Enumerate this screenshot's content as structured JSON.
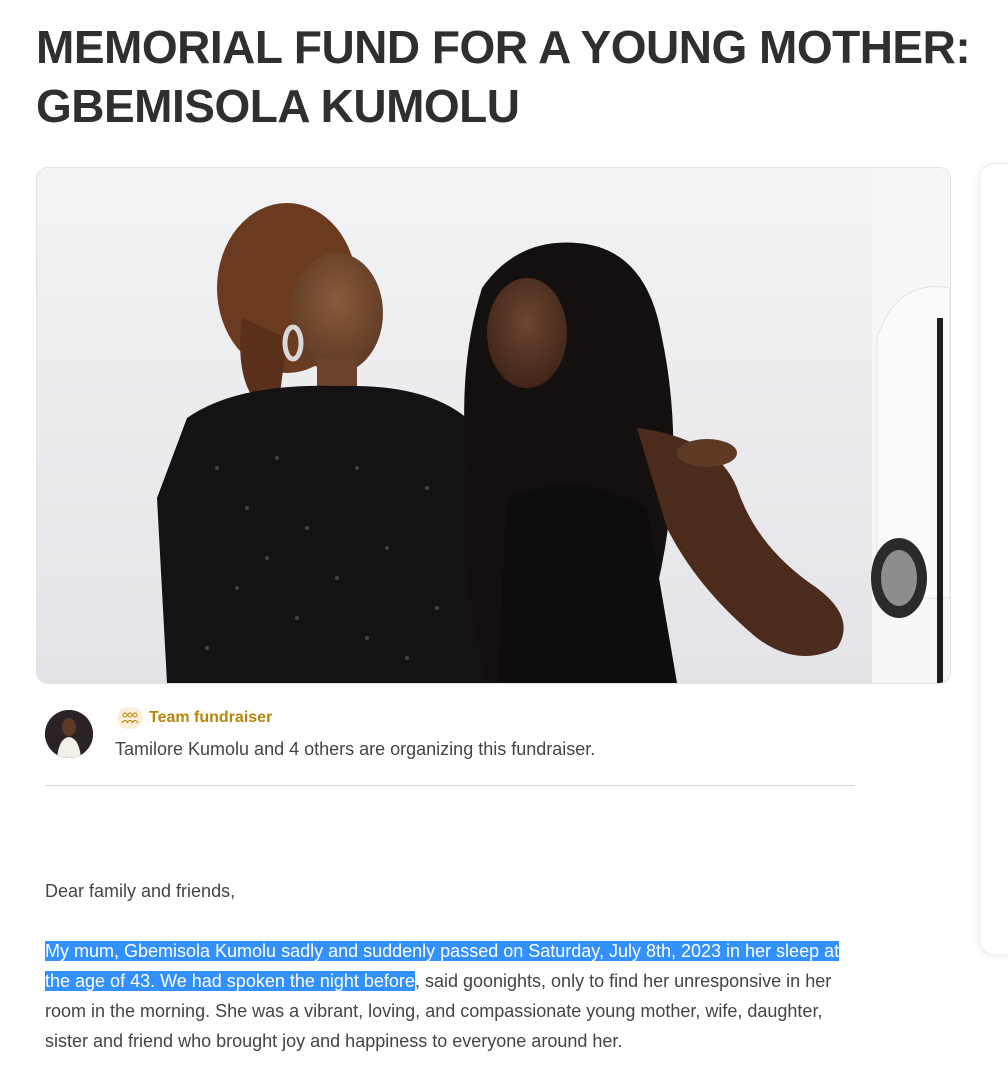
{
  "page": {
    "title_line1": "MEMORIAL FUND FOR A YOUNG MOTHER:",
    "title_line2": "GBEMISOLA  KUMOLU"
  },
  "organizer": {
    "team_label": "Team fundraiser",
    "text": "Tamilore Kumolu and 4 others are organizing this fundraiser.",
    "team_icon": "people-group-icon"
  },
  "story": {
    "greeting": "Dear family and friends,",
    "highlighted": "My mum, Gbemisola Kumolu sadly and suddenly passed on Saturday, July 8th, 2023 in her sleep at the age of 43. We had spoken the night before",
    "rest": ", said goonights, only to find her unresponsive in her room in the morning. She was a vibrant, loving, and compassionate young mother, wife, daughter, sister and friend who brought joy and happiness to everyone around her."
  },
  "colors": {
    "accent_gold": "#b8860b",
    "selection": "#3390ff"
  }
}
